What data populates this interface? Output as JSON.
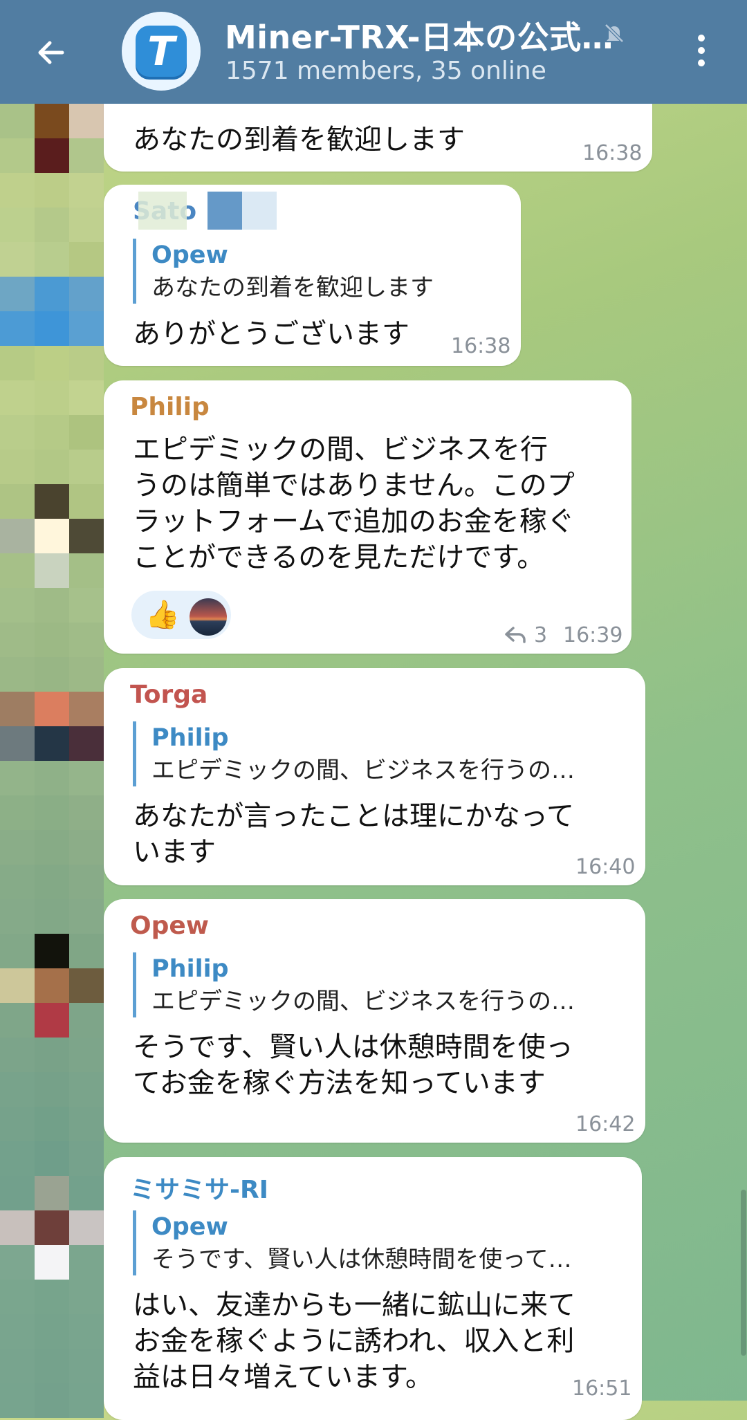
{
  "header": {
    "title": "Miner-TRX-日本の公式…",
    "subtitle": "1571 members, 35 online",
    "avatar_letter": "T"
  },
  "icons": {
    "back": "arrow-left-icon",
    "mute": "muted-bell-icon",
    "menu": "more-vertical-icon"
  },
  "messages": [
    {
      "text": "あなたの到着を歓迎します",
      "time": "16:38"
    },
    {
      "sender": "Sato",
      "reply_name": "Opew",
      "reply_text": "あなたの到着を歓迎します",
      "text": "ありがとうございます",
      "time": "16:38"
    },
    {
      "sender": "Philip",
      "text_lines": [
        "エピデミックの間、ビジネスを行",
        "うのは簡単ではありません。このプ",
        "ラットフォームで追加のお金を稼ぐ",
        "ことができるのを見ただけです。"
      ],
      "reaction_emoji": "👍",
      "replies": "3",
      "time": "16:39"
    },
    {
      "sender": "Torga",
      "reply_name": "Philip",
      "reply_text": "エピデミックの間、ビジネスを行うの…",
      "text_lines": [
        "あなたが言ったことは理にかなって",
        "います"
      ],
      "time": "16:40"
    },
    {
      "sender": "Opew",
      "reply_name": "Philip",
      "reply_text": "エピデミックの間、ビジネスを行うの…",
      "text_lines": [
        "そうです、賢い人は休憩時間を使っ",
        "てお金を稼ぐ方法を知っています"
      ],
      "time": "16:42"
    },
    {
      "sender": "ミサミサ-RI",
      "reply_name": "Opew",
      "reply_text": "そうです、賢い人は休憩時間を使って…",
      "text_lines": [
        "はい、友達からも一緒に鉱山に来て",
        "お金を稼ぐように誘われ、収入と利",
        "益は日々増えています。"
      ],
      "time": "16:51"
    }
  ],
  "colors": {
    "header": "#517da2",
    "name_philip": "#c8873f",
    "name_torga": "#c2544f",
    "name_opew": "#bf5a4d",
    "name_misa": "#3d8ac4",
    "reply_accent": "#5c9fd3"
  }
}
